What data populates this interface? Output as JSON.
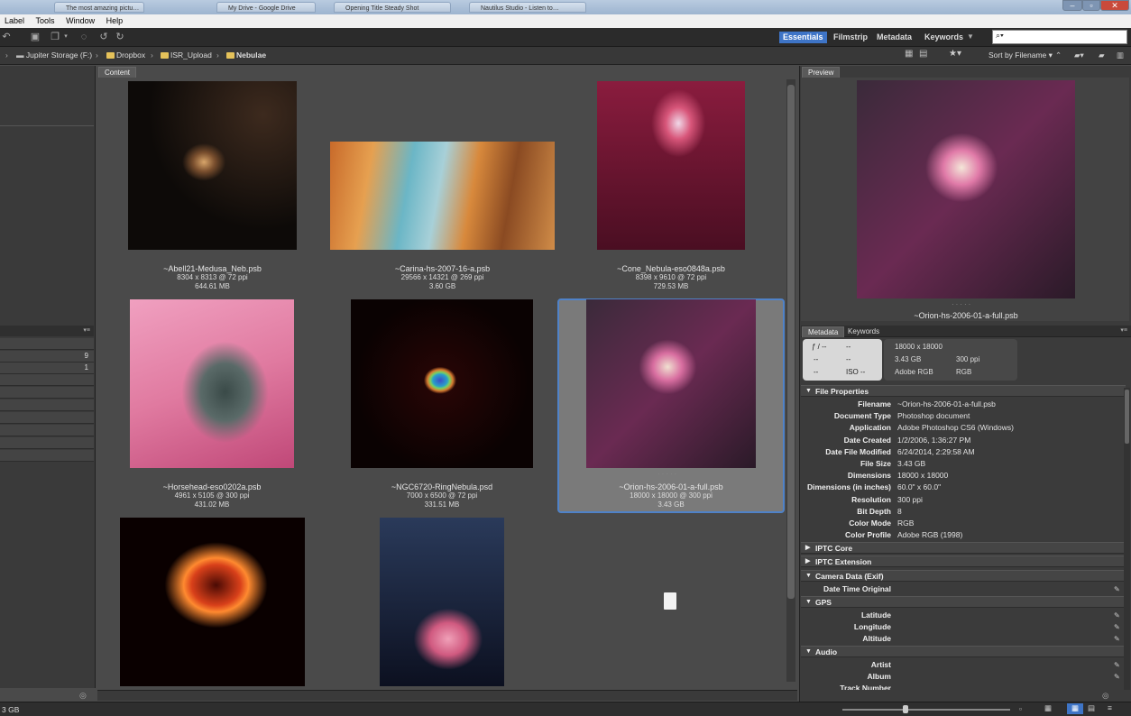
{
  "taskbar": {
    "tabs": [
      "The most amazing pictu…",
      "My Drive - Google Drive",
      "Opening Title Steady Shot",
      "Nautilus Studio - Listen to…"
    ]
  },
  "menu": {
    "items": [
      "Label",
      "Tools",
      "Window",
      "Help"
    ]
  },
  "workspaces": {
    "essentials": "Essentials",
    "filmstrip": "Filmstrip",
    "metadata": "Metadata",
    "keywords": "Keywords"
  },
  "search": {
    "placeholder": "⌕▾"
  },
  "sort": {
    "label": "Sort by Filename"
  },
  "path": {
    "drive": "Jupiter Storage (F:)",
    "dropbox": "Dropbox",
    "upload": "ISR_Upload",
    "current": "Nebulae"
  },
  "panels": {
    "content": "Content",
    "preview": "Preview",
    "metadata": "Metadata",
    "keywords": "Keywords"
  },
  "left": {
    "counts": [
      "9",
      "1"
    ]
  },
  "thumbnails": [
    {
      "filename": "~Abell21-Medusa_Neb.psb",
      "dims": "8304 x 8313 @ 72 ppi",
      "size": "644.61 MB"
    },
    {
      "filename": "~Carina-hs-2007-16-a.psb",
      "dims": "29566 x 14321 @ 269 ppi",
      "size": "3.60 GB"
    },
    {
      "filename": "~Cone_Nebula-eso0848a.psb",
      "dims": "8398 x 9610 @ 72 ppi",
      "size": "729.53 MB"
    },
    {
      "filename": "~Horsehead-eso0202a.psb",
      "dims": "4961 x 5105 @ 300 ppi",
      "size": "431.02 MB"
    },
    {
      "filename": "~NGC6720-RingNebula.psd",
      "dims": "7000 x 6500 @ 72 ppi",
      "size": "331.51 MB"
    },
    {
      "filename": "~Orion-hs-2006-01-a-full.psb",
      "dims": "18000 x 18000 @ 300 ppi",
      "size": "3.43 GB"
    }
  ],
  "preview": {
    "filename": "~Orion-hs-2006-01-a-full.psb"
  },
  "camera": {
    "fstop": "ƒ / --",
    "shutter": "--",
    "a": "--",
    "b": "--",
    "c": "--",
    "iso": "ISO --"
  },
  "summary": {
    "dims": "18000 x 18000",
    "size": "3.43 GB",
    "ppi": "300 ppi",
    "profile": "Adobe RGB",
    "mode": "RGB"
  },
  "sections": {
    "file_properties": "File Properties",
    "iptc_core": "IPTC Core",
    "iptc_ext": "IPTC Extension",
    "camera": "Camera Data (Exif)",
    "gps": "GPS",
    "audio": "Audio"
  },
  "file_properties": [
    {
      "k": "Filename",
      "v": "~Orion-hs-2006-01-a-full.psb"
    },
    {
      "k": "Document Type",
      "v": "Photoshop document"
    },
    {
      "k": "Application",
      "v": "Adobe Photoshop CS6 (Windows)"
    },
    {
      "k": "Date Created",
      "v": "1/2/2006, 1:36:27 PM"
    },
    {
      "k": "Date File Modified",
      "v": "6/24/2014, 2:29:58 AM"
    },
    {
      "k": "File Size",
      "v": "3.43 GB"
    },
    {
      "k": "Dimensions",
      "v": "18000 x 18000"
    },
    {
      "k": "Dimensions (in inches)",
      "v": "60.0\" x 60.0\""
    },
    {
      "k": "Resolution",
      "v": "300 ppi"
    },
    {
      "k": "Bit Depth",
      "v": "8"
    },
    {
      "k": "Color Mode",
      "v": "RGB"
    },
    {
      "k": "Color Profile",
      "v": "Adobe RGB (1998)"
    }
  ],
  "camera_rows": [
    "Date Time Original"
  ],
  "gps_rows": [
    "Latitude",
    "Longitude",
    "Altitude"
  ],
  "audio_rows": [
    "Artist",
    "Album",
    "Track Number"
  ],
  "status": {
    "left": "3 GB"
  },
  "colors": {
    "accent": "#3e74c6",
    "selection": "#4f82c8"
  }
}
